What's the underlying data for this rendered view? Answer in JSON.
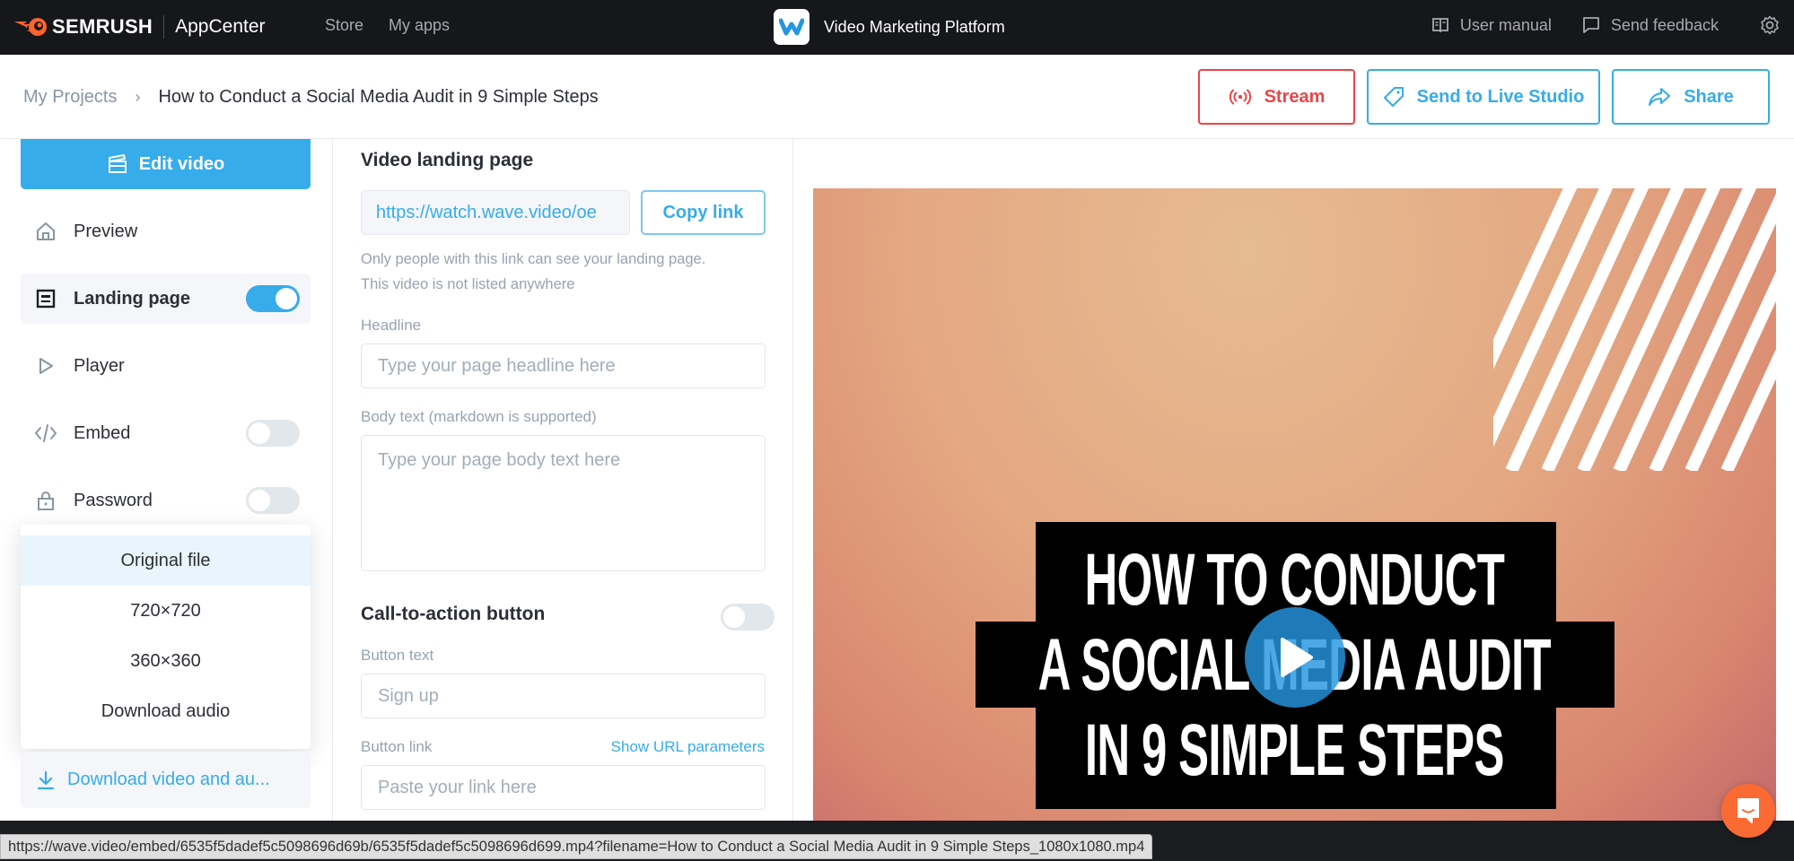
{
  "topbar": {
    "brand_name": "SEMRUSH",
    "brand_app": "AppCenter",
    "nav": [
      "Store",
      "My apps"
    ],
    "app_title": "Video Marketing Platform",
    "user_manual": "User manual",
    "send_feedback": "Send feedback",
    "icons": {
      "brand": "semrush-flame-icon",
      "app": "wave-logo-icon",
      "manual": "book-icon",
      "feedback": "chat-bubble-icon",
      "settings": "gear-icon"
    }
  },
  "breadcrumb": {
    "root": "My Projects",
    "current": "How to Conduct a Social Media Audit in 9 Simple Steps"
  },
  "actions": {
    "stream": "Stream",
    "send_to_live_studio": "Send to Live Studio",
    "share": "Share"
  },
  "colors": {
    "accent": "#36acea",
    "danger": "#ea4549",
    "topbar": "#16171b",
    "chat": "#fb6a32"
  },
  "sidebar": {
    "edit_video": "Edit video",
    "items": [
      {
        "label": "Preview",
        "icon": "home-icon",
        "toggle": null,
        "active": false
      },
      {
        "label": "Landing page",
        "icon": "page-layout-icon",
        "toggle": true,
        "active": true
      },
      {
        "label": "Player",
        "icon": "play-outline-icon",
        "toggle": null,
        "active": false
      },
      {
        "label": "Embed",
        "icon": "code-icon",
        "toggle": false,
        "active": false
      },
      {
        "label": "Password",
        "icon": "lock-icon",
        "toggle": false,
        "active": false
      }
    ],
    "download_menu": [
      "Original file",
      "720×720",
      "360×360",
      "Download audio"
    ],
    "download_button": "Download video and au..."
  },
  "form": {
    "title": "Video landing page",
    "url_value": "https://watch.wave.video/oe",
    "copy_link": "Copy link",
    "hint_line1": "Only people with this link can see your landing page.",
    "hint_line2": "This video is not listed anywhere",
    "headline_label": "Headline",
    "headline_placeholder": "Type your page headline here",
    "body_label": "Body text (markdown is supported)",
    "body_placeholder": "Type your page body text here",
    "cta_title": "Call-to-action button",
    "cta_enabled": false,
    "button_text_label": "Button text",
    "button_text_placeholder": "Sign up",
    "button_link_label": "Button link",
    "show_url_params": "Show URL parameters",
    "button_link_placeholder": "Paste your link here"
  },
  "preview": {
    "title_lines": [
      "HOW TO CONDUCT",
      "A SOCIAL MEDIA AUDIT",
      "IN 9 SIMPLE STEPS"
    ]
  },
  "status_url": "https://wave.video/embed/6535f5dadef5c5098696d69b/6535f5dadef5c5098696d699.mp4?filename=How to Conduct a Social Media Audit in 9 Simple Steps_1080x1080.mp4"
}
